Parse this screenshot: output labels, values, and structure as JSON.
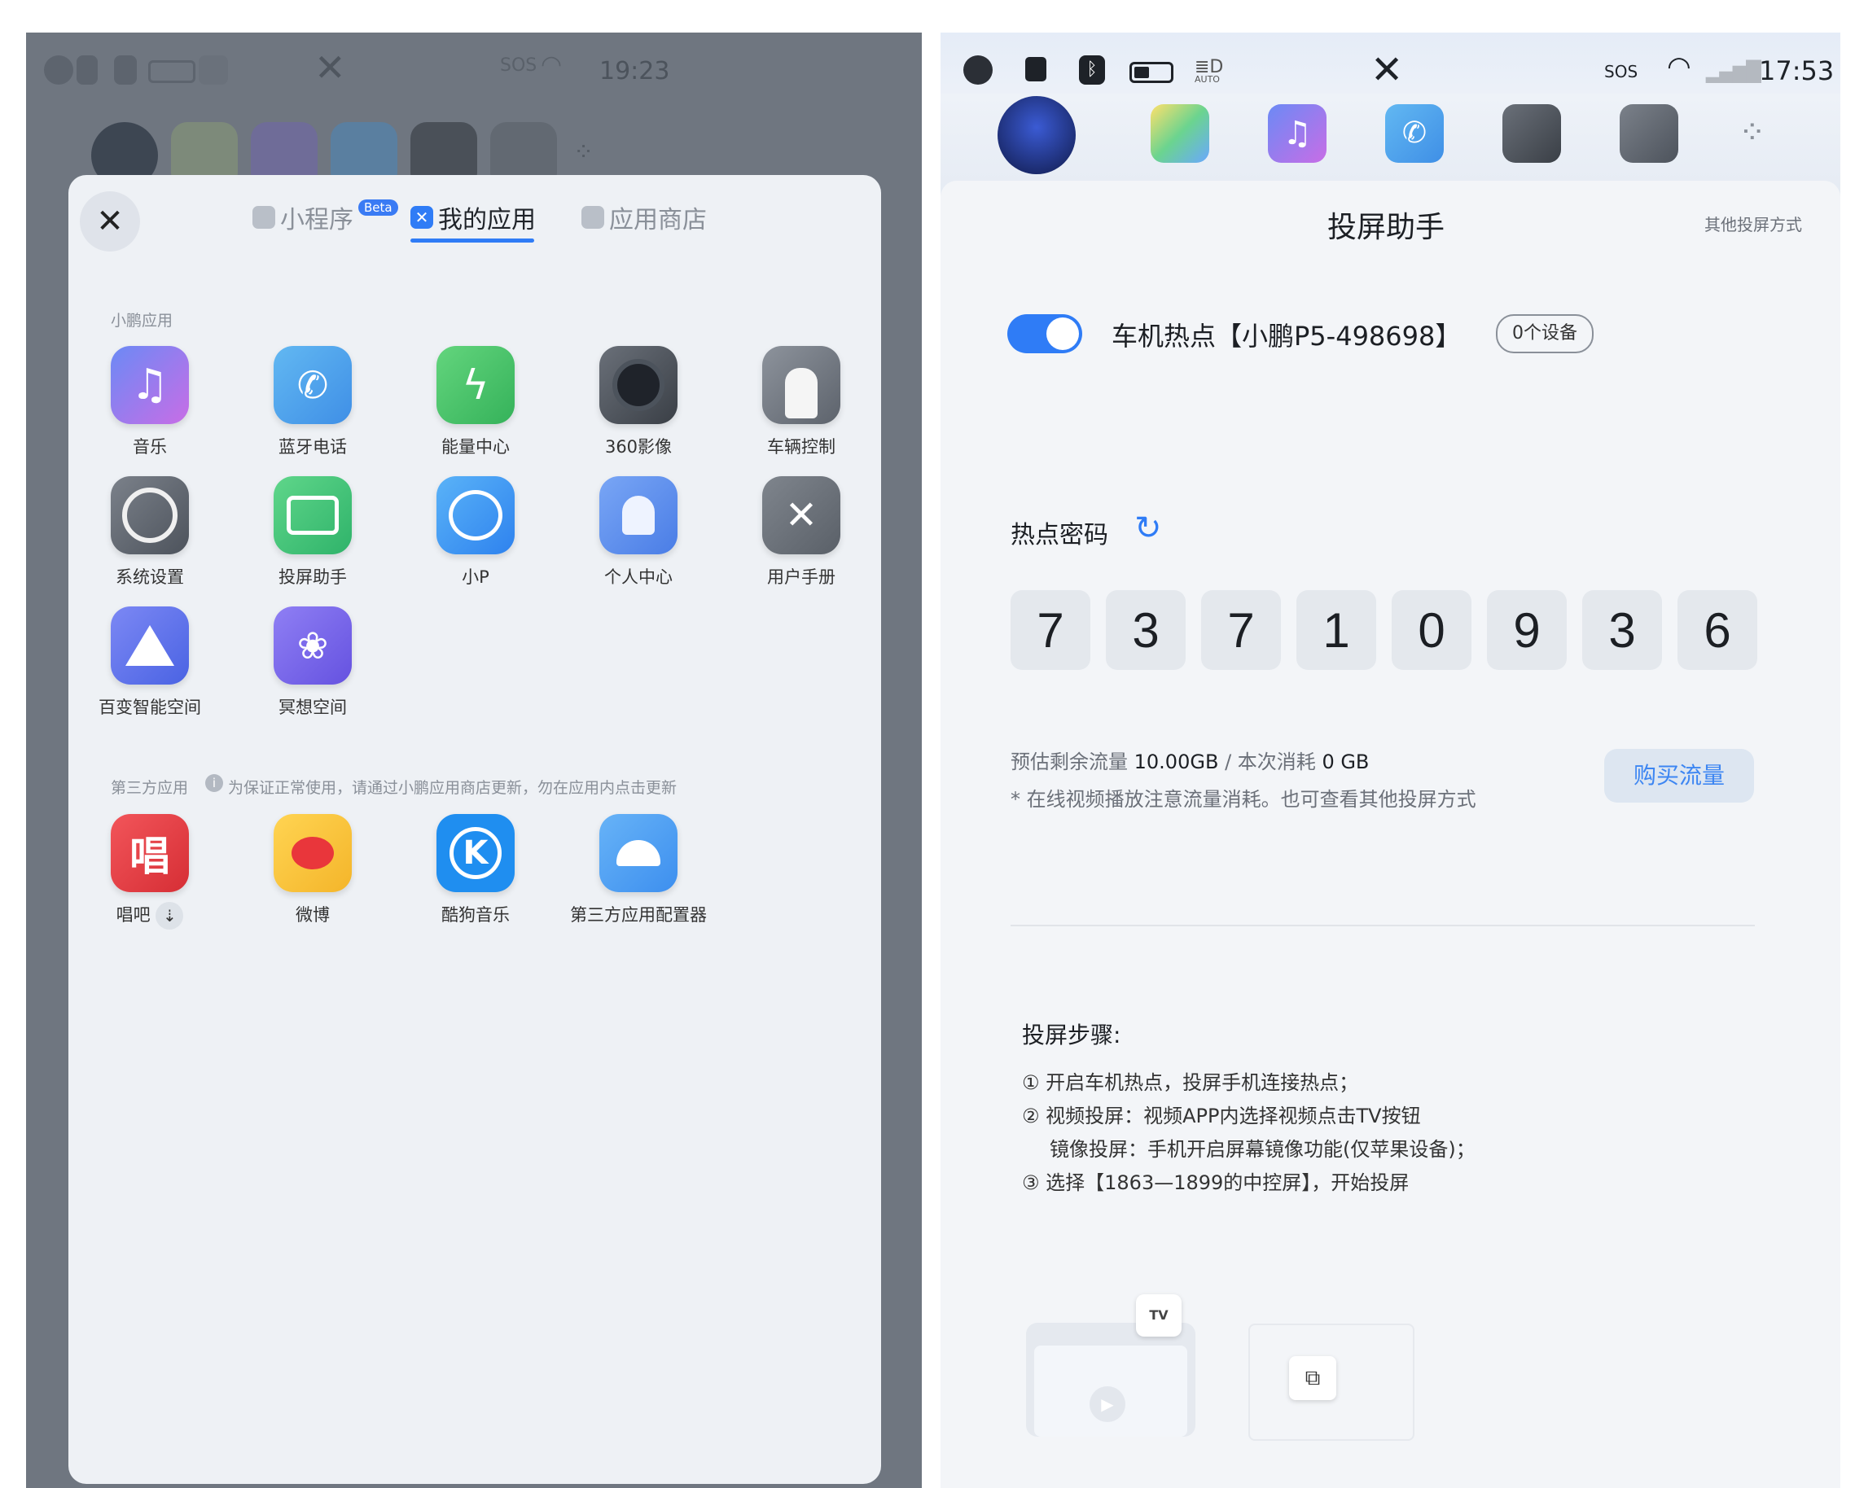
{
  "left": {
    "status": {
      "time": "19:23",
      "sos": "SOS"
    },
    "tabs": [
      {
        "label": "小程序",
        "badge": "Beta"
      },
      {
        "label": "我的应用"
      },
      {
        "label": "应用商店"
      }
    ],
    "section_xp": "小鹏应用",
    "xp_apps": [
      "音乐",
      "蓝牙电话",
      "能量中心",
      "360影像",
      "车辆控制",
      "系统设置",
      "投屏助手",
      "小P",
      "个人中心",
      "用户手册",
      "百变智能空间",
      "冥想空间"
    ],
    "section_third": "第三方应用",
    "third_notice": "为保证正常使用，请通过小鹏应用商店更新，勿在应用内点击更新",
    "third_apps": [
      "唱吧",
      "微博",
      "酷狗音乐",
      "第三方应用配置器"
    ]
  },
  "right": {
    "status": {
      "time": "17:53",
      "sos": "SOS",
      "auto": "AUTO"
    },
    "title": "投屏助手",
    "other_link": "其他投屏方式",
    "hotspot_label": "车机热点【小鹏P5-498698】",
    "device_badge": "0个设备",
    "hotspot_on": true,
    "password_label": "热点密码",
    "password_digits": [
      "7",
      "3",
      "7",
      "1",
      "0",
      "9",
      "3",
      "6"
    ],
    "traffic_remaining_label": "预估剩余流量",
    "traffic_remaining_value": "10.00GB",
    "traffic_sep": "/",
    "traffic_used_label": "本次消耗",
    "traffic_used_value": "0 GB",
    "traffic_note": "* 在线视频播放注意流量消耗。也可查看其他投屏方式",
    "buy_button": "购买流量",
    "steps_title": "投屏步骤:",
    "steps": [
      "① 开启车机热点，投屏手机连接热点；",
      "② 视频投屏：视频APP内选择视频点击TV按钮",
      "镜像投屏：手机开启屏幕镜像功能(仅苹果设备)；",
      "③ 选择【1863—1899的中控屏】，开始投屏"
    ],
    "tv_icon_text": "TV"
  },
  "colors": {
    "accent": "#2f7cf6",
    "overlay": "#6f7680",
    "panel": "#eef1f5"
  }
}
